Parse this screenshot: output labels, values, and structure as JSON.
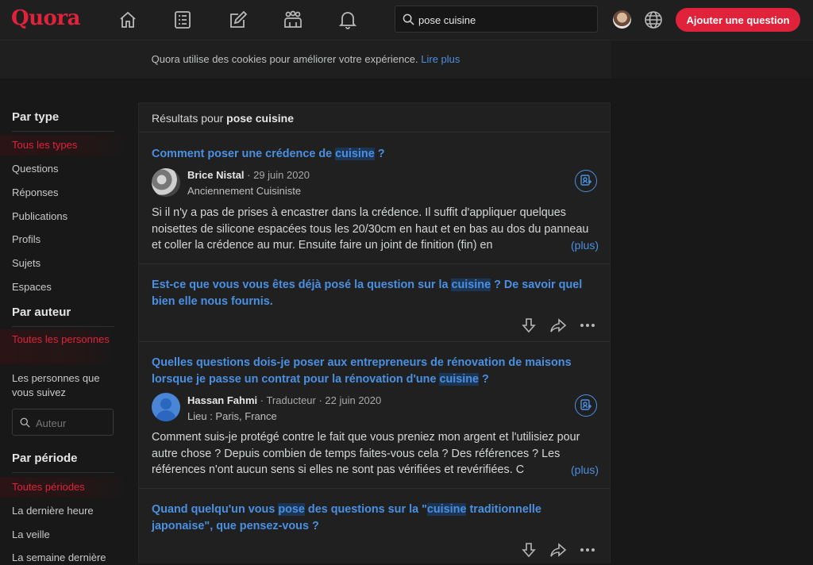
{
  "nav": {
    "logo": "Quora",
    "search_value": "pose cuisine",
    "ask_button": "Ajouter une question",
    "icons": [
      "home-icon",
      "following-icon",
      "write-icon",
      "spaces-icon",
      "notifications-icon",
      "search-icon",
      "globe-icon"
    ]
  },
  "cookie": {
    "text": "Quora utilise des cookies pour améliorer votre expérience.",
    "link": "Lire plus"
  },
  "sidebar": {
    "type_heading": "Par type",
    "types": [
      "Tous les types",
      "Questions",
      "Réponses",
      "Publications",
      "Profils",
      "Sujets",
      "Espaces"
    ],
    "author_heading": "Par auteur",
    "authors": [
      "Toutes les personnes",
      "Les personnes que vous suivez"
    ],
    "author_placeholder": "Auteur",
    "period_heading": "Par période",
    "periods": [
      "Toutes périodes",
      "La dernière heure",
      "La veille",
      "La semaine dernière"
    ]
  },
  "results": {
    "prefix": "Résultats pour",
    "query": "pose cuisine",
    "items": [
      {
        "title_parts": [
          "Comment poser une crédence de ",
          "cuisine",
          " ?"
        ],
        "author": "Brice Nistal",
        "meta": " · 29 juin 2020",
        "credential": "Anciennement Cuisiniste",
        "body": "Si il n'y a pas de prises à encastrer dans la crédence. Il suffit d'appliquer quelques noisettes de silicone espacées tous les 20/30cm en haut et en bas au dos du panneau et coller la crédence au mur. Ensuite faire un joint de finition (fin) en",
        "more": "(plus)"
      },
      {
        "title_parts": [
          "Est-ce que vous vous êtes déjà posé la question sur la ",
          "cuisine",
          " ? De savoir quel bien elle nous fournis."
        ]
      },
      {
        "title_parts": [
          "Quelles questions dois-je poser aux entrepreneurs de rénovation de maisons lorsque je passe un contrat pour la rénovation d'une ",
          "cuisine",
          " ?"
        ],
        "author": "Hassan Fahmi",
        "meta": " · Traducteur · 22 juin 2020",
        "credential": "Lieu : Paris, France",
        "body": "Comment suis-je protégé contre le fait que vous preniez mon argent et l'utilisiez pour autre chose ? Depuis combien de temps faites-vous cela ? Des références ? Les références n'ont aucun sens si elles ne sont pas vérifiées et revérifiées. C",
        "more": "(plus)"
      },
      {
        "title_parts": [
          "Quand quelqu'un vous ",
          "pose",
          " des questions sur la \"",
          "cuisine",
          " traditionnelle japonaise\", que pensez-vous ?"
        ]
      }
    ]
  }
}
